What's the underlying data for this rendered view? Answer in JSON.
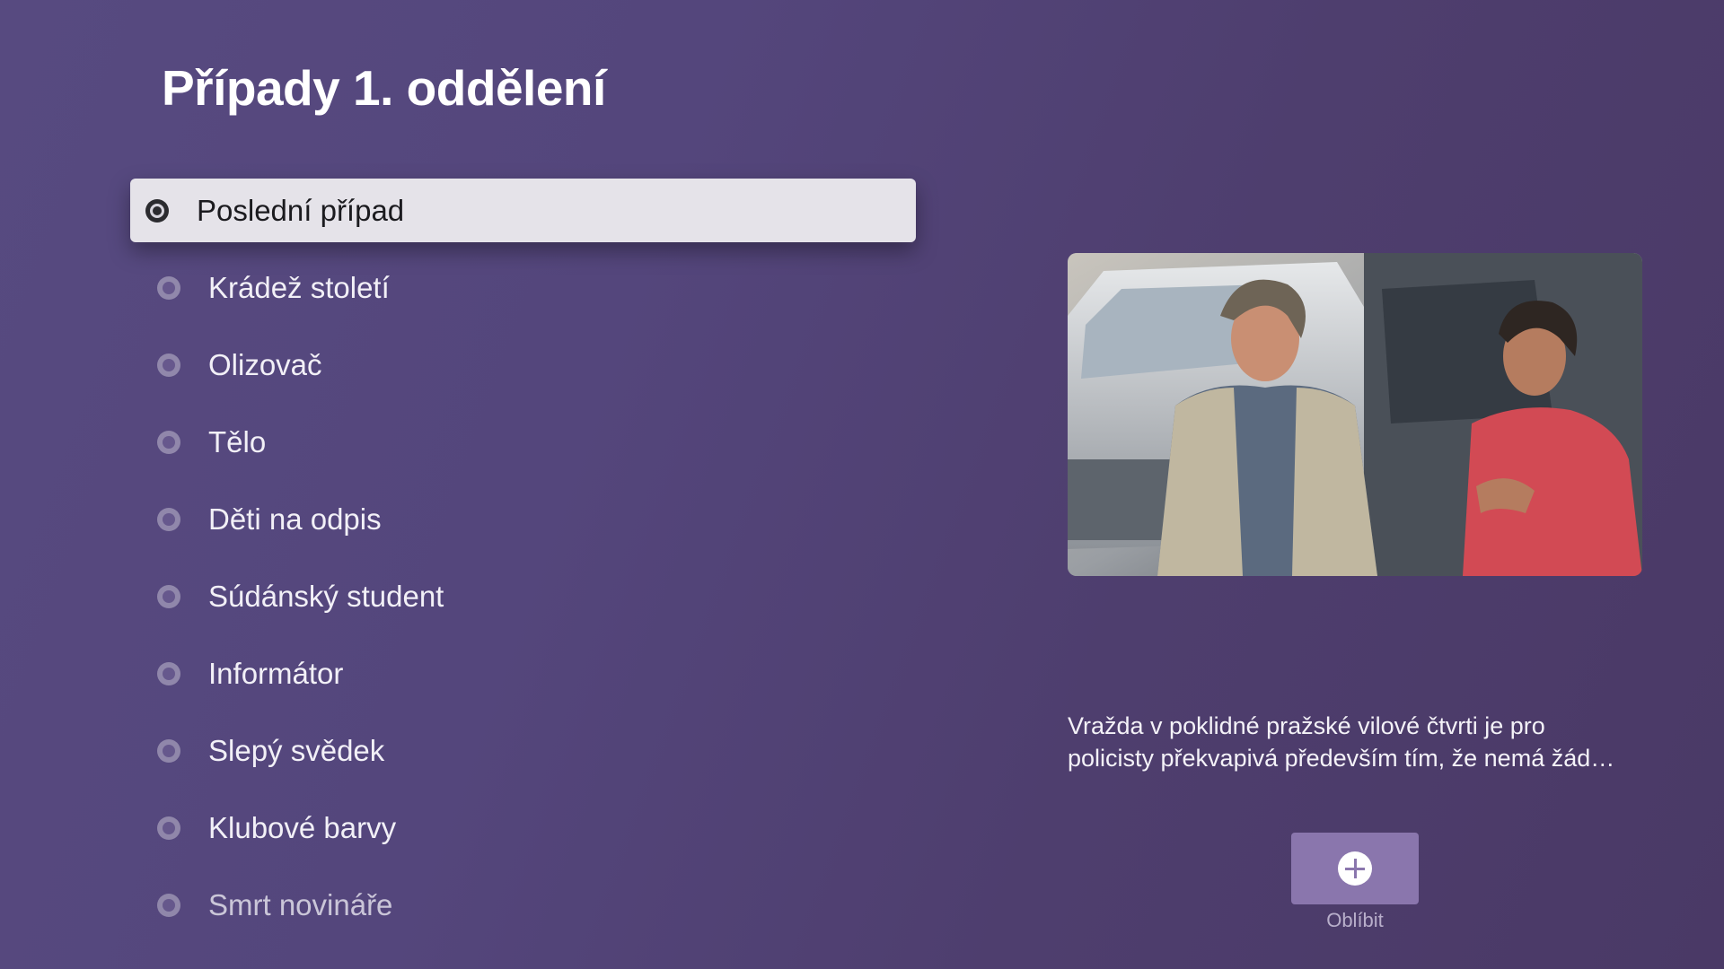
{
  "header": {
    "title": "Případy 1. oddělení"
  },
  "episodes": {
    "selected_index": 0,
    "items": [
      {
        "label": "Poslední případ"
      },
      {
        "label": "Krádež století"
      },
      {
        "label": "Olizovač"
      },
      {
        "label": "Tělo"
      },
      {
        "label": "Děti na odpis"
      },
      {
        "label": "Súdánský student"
      },
      {
        "label": "Informátor"
      },
      {
        "label": "Slepý svědek"
      },
      {
        "label": "Klubové barvy"
      },
      {
        "label": "Smrt novináře"
      }
    ]
  },
  "detail": {
    "description_line1": "Vražda v poklidné pražské vilové čtvrti je pro",
    "description_line2": "policisty překvapivá především tím, že nemá žád…",
    "favorite_label": "Oblíbit",
    "favorite_icon": "plus-circle-icon"
  },
  "colors": {
    "background": "#54467c",
    "focus_background": "#e5e3e9",
    "button_background": "#8a76ad"
  }
}
